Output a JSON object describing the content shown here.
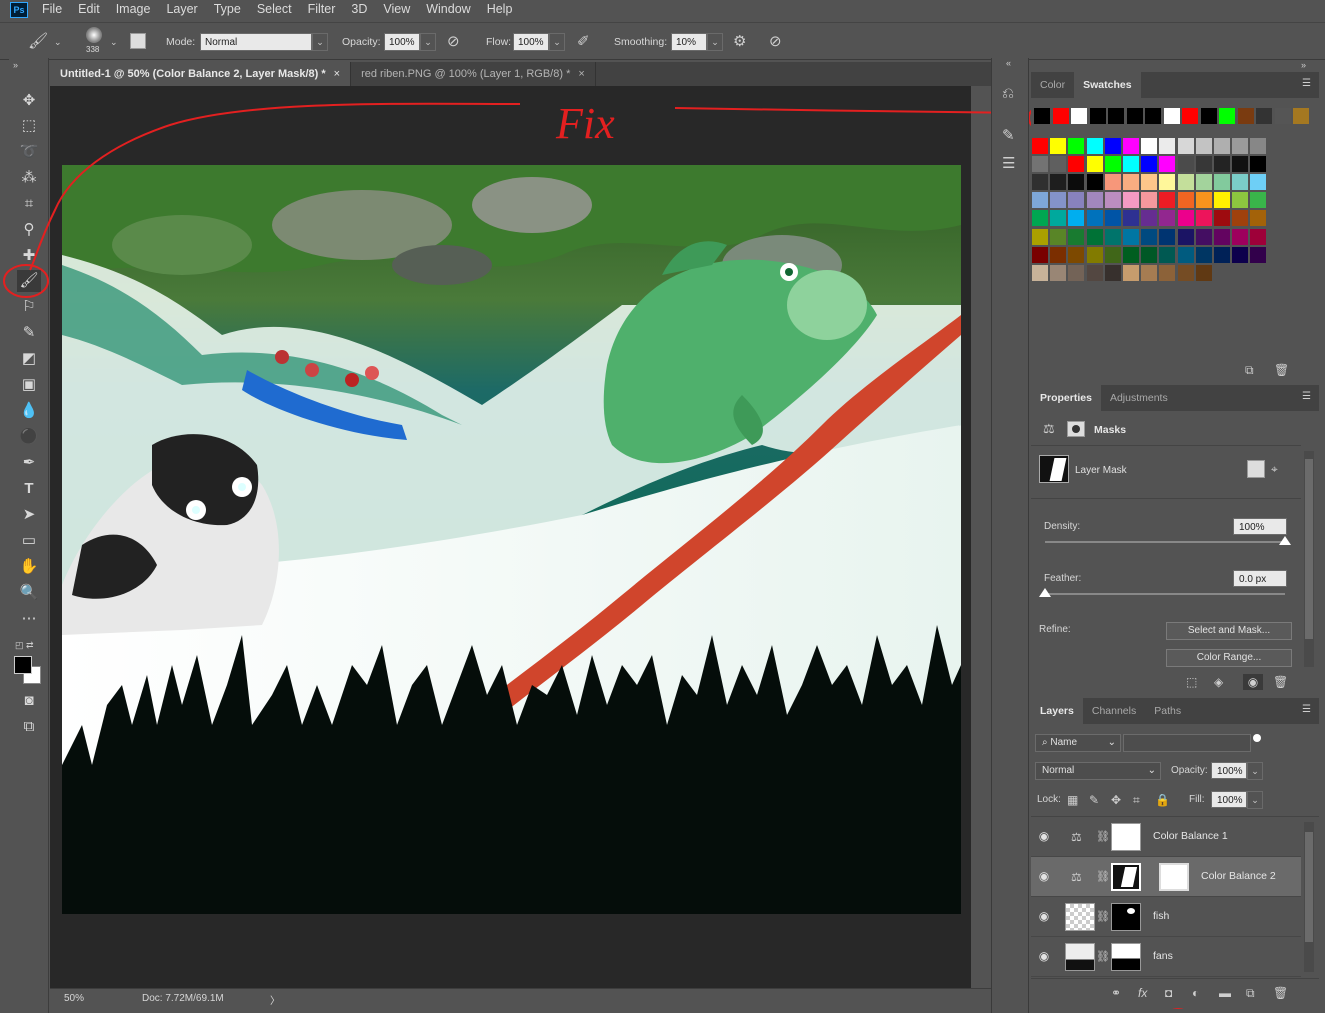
{
  "menu": [
    "File",
    "Edit",
    "Image",
    "Layer",
    "Type",
    "Select",
    "Filter",
    "3D",
    "View",
    "Window",
    "Help"
  ],
  "app_logo": "Ps",
  "options": {
    "brush_size": "338",
    "mode_label": "Mode:",
    "mode_value": "Normal",
    "opacity_label": "Opacity:",
    "opacity_value": "100%",
    "flow_label": "Flow:",
    "flow_value": "100%",
    "smoothing_label": "Smoothing:",
    "smoothing_value": "10%"
  },
  "doc_tabs": [
    {
      "title": "Untitled-1 @ 50% (Color Balance 2, Layer Mask/8) *",
      "close": "×"
    },
    {
      "title": "red riben.PNG @ 100% (Layer 1, RGB/8) *",
      "close": "×"
    }
  ],
  "annotation_text": "Fix",
  "status": {
    "zoom": "50%",
    "doc": "Doc: 7.72M/69.1M",
    "arrow": "〉"
  },
  "color_panel": {
    "tabs": [
      "Color",
      "Swatches"
    ],
    "recent_swatches": [
      "#000000",
      "#ff0000",
      "#ffffff",
      "#000000",
      "#000000",
      "#000000",
      "#000000",
      "#ffffff",
      "#ff0000",
      "#000000",
      "#00ff00",
      "#7a3b10",
      "#333333",
      "#555555",
      "#a47821"
    ],
    "swatch_rows": [
      [
        "#ff0000",
        "#ffff00",
        "#00ff00",
        "#00ffff",
        "#0000ff",
        "#ff00ff",
        "#ffffff",
        "#ebebeb",
        "#d7d7d7",
        "#c3c3c3",
        "#afafaf",
        "#9b9b9b",
        "#878787"
      ],
      [
        "#737373",
        "#5f5f5f",
        "#ff0000",
        "#ffff00",
        "#00ff00",
        "#00ffff",
        "#0000ff",
        "#ff00ff",
        "#4b4b4b",
        "#373737",
        "#232323",
        "#111111",
        "#000000"
      ],
      [
        "#303030",
        "#1e1e1e",
        "#0c0c0c",
        "#000000",
        "#f7977a",
        "#f9ad81",
        "#fdc68a",
        "#fff79a",
        "#c4df9b",
        "#a3d39c",
        "#82ca9d",
        "#7bcdc8",
        "#6ecff6"
      ],
      [
        "#7ea7d8",
        "#8493ca",
        "#8882be",
        "#a187be",
        "#bc8dbf",
        "#f49ac2",
        "#f6989d",
        "#ed1c24",
        "#f26522",
        "#f7941d",
        "#fff200",
        "#8dc73f",
        "#39b54a"
      ],
      [
        "#00a651",
        "#00a99d",
        "#00aeef",
        "#0072bc",
        "#0054a6",
        "#2e3192",
        "#662d91",
        "#92278f",
        "#ec008c",
        "#ed145b",
        "#9e0b0f",
        "#a0410d",
        "#a36209"
      ],
      [
        "#aba000",
        "#598527",
        "#197b30",
        "#007236",
        "#00746b",
        "#0076a3",
        "#004a80",
        "#003471",
        "#1b1464",
        "#440e62",
        "#630460",
        "#9e005d",
        "#9e0039"
      ],
      [
        "#790000",
        "#7b2e00",
        "#7d4900",
        "#827b00",
        "#406618",
        "#005e20",
        "#005826",
        "#005952",
        "#005b7f",
        "#003663",
        "#002157",
        "#0d004c",
        "#32004b"
      ],
      [
        "#c7b299",
        "#998675",
        "#736357",
        "#534741",
        "#37302d",
        "#c69c6d",
        "#a67c52",
        "#8c6239",
        "#754c24",
        "#603913"
      ]
    ]
  },
  "properties": {
    "tabs": [
      "Properties",
      "Adjustments"
    ],
    "masks_title": "Masks",
    "layer_mask_label": "Layer Mask",
    "density_label": "Density:",
    "density_value": "100%",
    "density_fraction": 1.0,
    "feather_label": "Feather:",
    "feather_value": "0.0 px",
    "feather_fraction": 0.0,
    "refine_label": "Refine:",
    "select_mask_btn": "Select and Mask...",
    "color_range_btn": "Color Range..."
  },
  "layers": {
    "tabs": [
      "Layers",
      "Channels",
      "Paths"
    ],
    "filter_kind": "Name",
    "blend_mode": "Normal",
    "opacity_label": "Opacity:",
    "opacity_value": "100%",
    "lock_label": "Lock:",
    "fill_label": "Fill:",
    "fill_value": "100%",
    "items": [
      {
        "name": "Color Balance 1"
      },
      {
        "name": "Color Balance 2"
      },
      {
        "name": "fish"
      },
      {
        "name": "fans"
      }
    ]
  }
}
